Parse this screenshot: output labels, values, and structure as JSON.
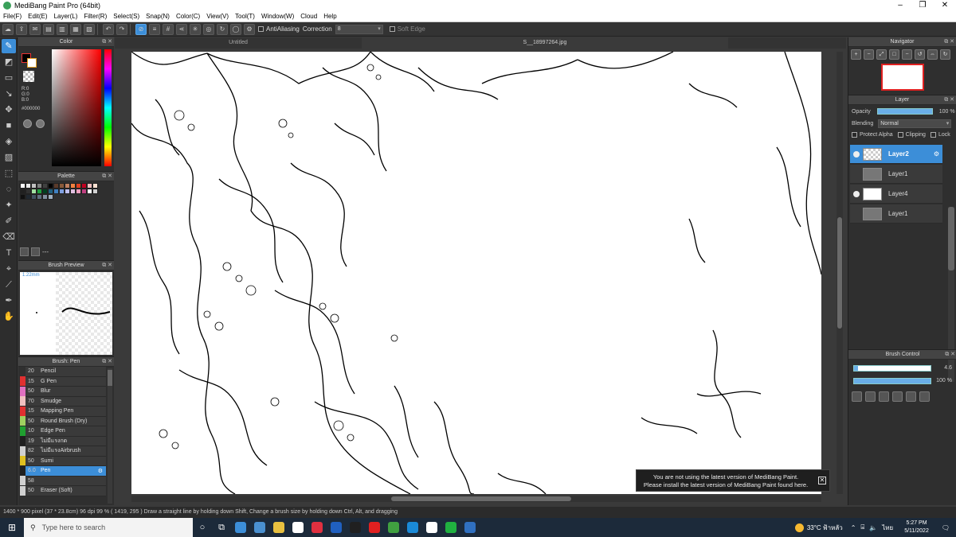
{
  "window": {
    "title": "MediBang Paint Pro (64bit)",
    "controls": [
      "–",
      "❐",
      "✕"
    ]
  },
  "menu": [
    "File(F)",
    "Edit(E)",
    "Layer(L)",
    "Filter(R)",
    "Select(S)",
    "Snap(N)",
    "Color(C)",
    "View(V)",
    "Tool(T)",
    "Window(W)",
    "Cloud",
    "Help"
  ],
  "toolbar": {
    "antialiasing_label": "AntiAliasing",
    "correction_label": "Correction",
    "correction_value": "8",
    "soft_edge_label": "Soft Edge"
  },
  "color_panel": {
    "title": "Color",
    "r": "R:0",
    "g": "G:0",
    "b": "B:0",
    "hex": "#000000",
    "fg_color": "#000000",
    "bg_color": "#ffffff"
  },
  "palette_panel": {
    "title": "Palette",
    "more_label": "---",
    "colors": [
      "#ffffff",
      "#e8e8e8",
      "#c0c0c0",
      "#808080",
      "#404040",
      "#000000",
      "#5a3a2a",
      "#8a5a3a",
      "#c08060",
      "#f08040",
      "#e04020",
      "#c00020",
      "#f0c0c0",
      "#f8e0d0",
      "#202020",
      "#303030",
      "#a0e0a0",
      "#20a040",
      "#004020",
      "#206080",
      "#4080c0",
      "#80a0e0",
      "#c0c0f0",
      "#e0c0e0",
      "#f0a0c0",
      "#c04080",
      "#ffffff",
      "#d0d0d0",
      "#101010",
      "#202830",
      "#405060",
      "#607080",
      "#8090a0",
      "#a0b0c0"
    ]
  },
  "brush_preview": {
    "title": "Brush Preview",
    "size": "1.22mm"
  },
  "brush_panel": {
    "title": "Brush: Pen",
    "brushes": [
      {
        "size": "20",
        "name": "Pencil",
        "color": "#303030"
      },
      {
        "size": "15",
        "name": "G Pen",
        "color": "#e03030"
      },
      {
        "size": "50",
        "name": "Blur",
        "color": "#e070c0"
      },
      {
        "size": "70",
        "name": "Smudge",
        "color": "#f0c0c0"
      },
      {
        "size": "15",
        "name": "Mapping Pen",
        "color": "#e03030"
      },
      {
        "size": "50",
        "name": "Round Brush (Dry)",
        "color": "#a0d060"
      },
      {
        "size": "10",
        "name": "Edge Pen",
        "color": "#20a030"
      },
      {
        "size": "19",
        "name": "ไม่มีแรงกด",
        "color": "#202020"
      },
      {
        "size": "82",
        "name": "ไม่มีแรงAirbrush",
        "color": "#d0d0d0"
      },
      {
        "size": "50",
        "name": "Sumi",
        "color": "#e0c020"
      },
      {
        "size": "6.0",
        "name": "Pen",
        "color": "#202020"
      },
      {
        "size": "58",
        "name": "",
        "color": "#d0d0d0"
      },
      {
        "size": "50",
        "name": "Eraser (Soft)",
        "color": "#d0d0d0"
      }
    ],
    "active_index": 10
  },
  "tabs": {
    "tab1": "Untitled",
    "tab2": "S__18997264.jpg"
  },
  "navigator": {
    "title": "Navigator"
  },
  "layer_panel": {
    "title": "Layer",
    "opacity_label": "Opacity",
    "opacity_value": "100 %",
    "opacity_fraction": 1.0,
    "blending_label": "Blending",
    "blending_value": "Normal",
    "protect_alpha": "Protect Alpha",
    "clipping": "Clipping",
    "lock": "Lock",
    "layers": [
      {
        "name": "Layer2",
        "active": true,
        "visible": true
      },
      {
        "name": "Layer1",
        "active": false,
        "visible": false
      },
      {
        "name": "Layer4",
        "active": false,
        "visible": true
      },
      {
        "name": "Layer1",
        "active": false,
        "visible": false
      }
    ]
  },
  "brush_control": {
    "title": "Brush Control",
    "size_value": "4.6",
    "size_fraction": 0.05,
    "opacity_value": "100 %",
    "opacity_fraction": 1.0
  },
  "notification": {
    "line1": "You are not using the latest version of MediBang Paint.",
    "line2": "Please install the latest version of MediBang Paint found here."
  },
  "status": "1400 * 900 pixel  (37 * 23.8cm)  96 dpi  99 %  ( 1419, 295 )  Draw a straight line by holding down Shift, Change a brush size by holding down Ctrl, Alt, and dragging",
  "taskbar": {
    "search_placeholder": "Type here to search",
    "weather": "33°C  ฟ้าหลัว",
    "lang": "ไทย",
    "time": "5:27 PM",
    "date": "5/11/2022",
    "apps": [
      "#3c8ed8",
      "#4a90d0",
      "#e8c040",
      "#ffffff",
      "#e03040",
      "#2060c0",
      "#202020",
      "#e02020",
      "#40a040",
      "#1a8ad8",
      "#ffffff",
      "#20b040",
      "#3070c0"
    ]
  }
}
